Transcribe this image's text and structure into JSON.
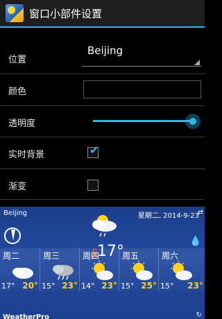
{
  "app": {
    "title": "窗口小部件设置",
    "icon": "weather-app-icon"
  },
  "settings": {
    "location": {
      "label": "位置",
      "value": "Beijing"
    },
    "color": {
      "label": "颜色",
      "value": "#000000"
    },
    "transparency": {
      "label": "透明度",
      "value": 1.0
    },
    "live_background": {
      "label": "实时背景",
      "checked": true
    },
    "gradient": {
      "label": "渐变",
      "checked": false
    }
  },
  "widget": {
    "city": "Beijing",
    "date": "星期二, 2014-9-23",
    "current_temp": "17°",
    "current_icon": "sun-cloud-rain-icon",
    "brand": "WeatherPro",
    "forecast": [
      {
        "day": "周二",
        "low": "17°",
        "high": "20°",
        "icon": "cloud-icon"
      },
      {
        "day": "周三",
        "low": "15°",
        "high": "23°",
        "icon": "rain-cloud-icon"
      },
      {
        "day": "周四",
        "low": "14°",
        "high": "23°",
        "icon": "sun-cloud-icon"
      },
      {
        "day": "周五",
        "low": "15°",
        "high": "25°",
        "icon": "sun-cloud-icon"
      },
      {
        "day": "周六",
        "low": "15°",
        "high": "23°",
        "icon": "sun-cloud-icon"
      }
    ]
  },
  "colors": {
    "accent": "#33b5e5",
    "high_temp": "#ffd21f",
    "widget_bg": "#234aa0"
  }
}
